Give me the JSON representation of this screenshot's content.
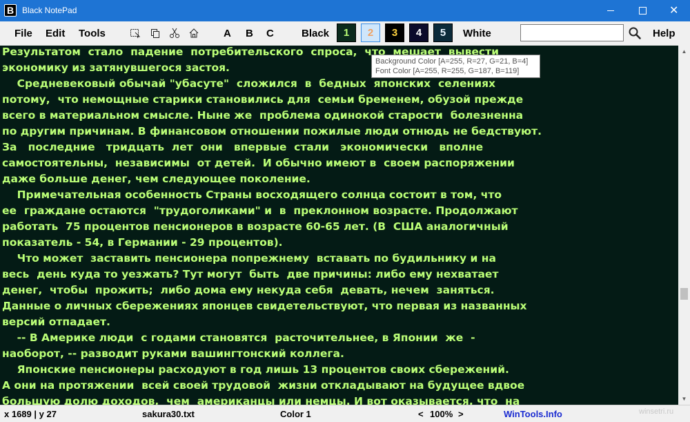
{
  "window": {
    "title": "Black NotePad",
    "icon_letter": "B"
  },
  "menu": {
    "file": "File",
    "edit": "Edit",
    "tools": "Tools"
  },
  "toolbar": {
    "font_buttons": [
      "A",
      "B",
      "C"
    ],
    "black_label": "Black",
    "white_label": "White",
    "swatches": [
      {
        "label": "1",
        "bg": "#0b2a1d",
        "fg": "#bbff77"
      },
      {
        "label": "2",
        "bg": "#cfe6fb",
        "fg": "#f0a060"
      },
      {
        "label": "3",
        "bg": "#000000",
        "fg": "#ffd23f"
      },
      {
        "label": "4",
        "bg": "#0b0b2b",
        "fg": "#ffffff"
      },
      {
        "label": "5",
        "bg": "#0b2a3a",
        "fg": "#e8f4ff"
      }
    ],
    "search_value": "",
    "help_label": "Help"
  },
  "tooltip": {
    "line1": "Background Color [A=255, R=27, G=21, B=4]",
    "line2": "Font Color [A=255, R=255, G=187, B=119]"
  },
  "editor": {
    "bg_color": "#041b15",
    "font_color": "#bbff77",
    "lines": [
      "Результатом  стало  падение  потребительского  спроса,  что  мешает  вывести",
      "экономику из затянувшегося застоя.",
      "    Средневековый обычай \"убасуте\"  сложился  в  бедных  японских  селениях",
      "потому,  что немощные старики становились для  семьи бременем, обузой прежде",
      "всего в материальном смысле. Ныне же  проблема одинокой старости  болезненна",
      "по другим причинам. В финансовом отношении пожилые люди отнюдь не бедствуют.",
      "За   последние   тридцать  лет  они   впервые  стали   экономически   вполне",
      "самостоятельны,  независимы  от детей.  И обычно имеют в  своем распоряжении",
      "даже больше денег, чем следующее поколение.",
      "    Примечательная особенность Страны восходящего солнца состоит в том, что",
      "ее  граждане остаются  \"трудоголиками\" и  в  преклонном возрасте. Продолжают",
      "работать  75 процентов пенсионеров в возрасте 60-65 лет. (В  США аналогичный",
      "показатель - 54, в Германии - 29 процентов).",
      "    Что может  заставить пенсионера попрежнему  вставать по будильнику и на",
      "весь  день куда то уезжать? Тут могут  быть  две причины: либо ему нехватает",
      "денег,  чтобы  прожить;  либо дома ему некуда себя  девать, нечем  заняться.",
      "Данные о личных сбережениях японцев свидетельствуют, что первая из названных",
      "версий отпадает.",
      "    -- В Америке люди  с годами становятся  расточительнее, в Японии  же  -",
      "наоборот, -- разводит руками вашингтонский коллега.",
      "    Японские пенсионеры расходуют в год лишь 13 процентов своих сбережений.",
      "А они на протяжении  всей своей трудовой  жизни откладывают на будущее вдвое",
      "большую долю доходов,  чем  американцы или немцы. И вот оказывается, что  на"
    ]
  },
  "status": {
    "position": "x 1689 | y 27",
    "filename": "sakura30.txt",
    "color_scheme": "Color 1",
    "zoom_prev": "<",
    "zoom": "100%",
    "zoom_next": ">",
    "site": "WinTools.Info"
  },
  "watermark": "winsetri.ru",
  "icons": {
    "search": "magnifier-icon",
    "select_all": "select-all-icon",
    "copy": "copy-icon",
    "cut": "scissors-icon",
    "home": "home-icon"
  }
}
